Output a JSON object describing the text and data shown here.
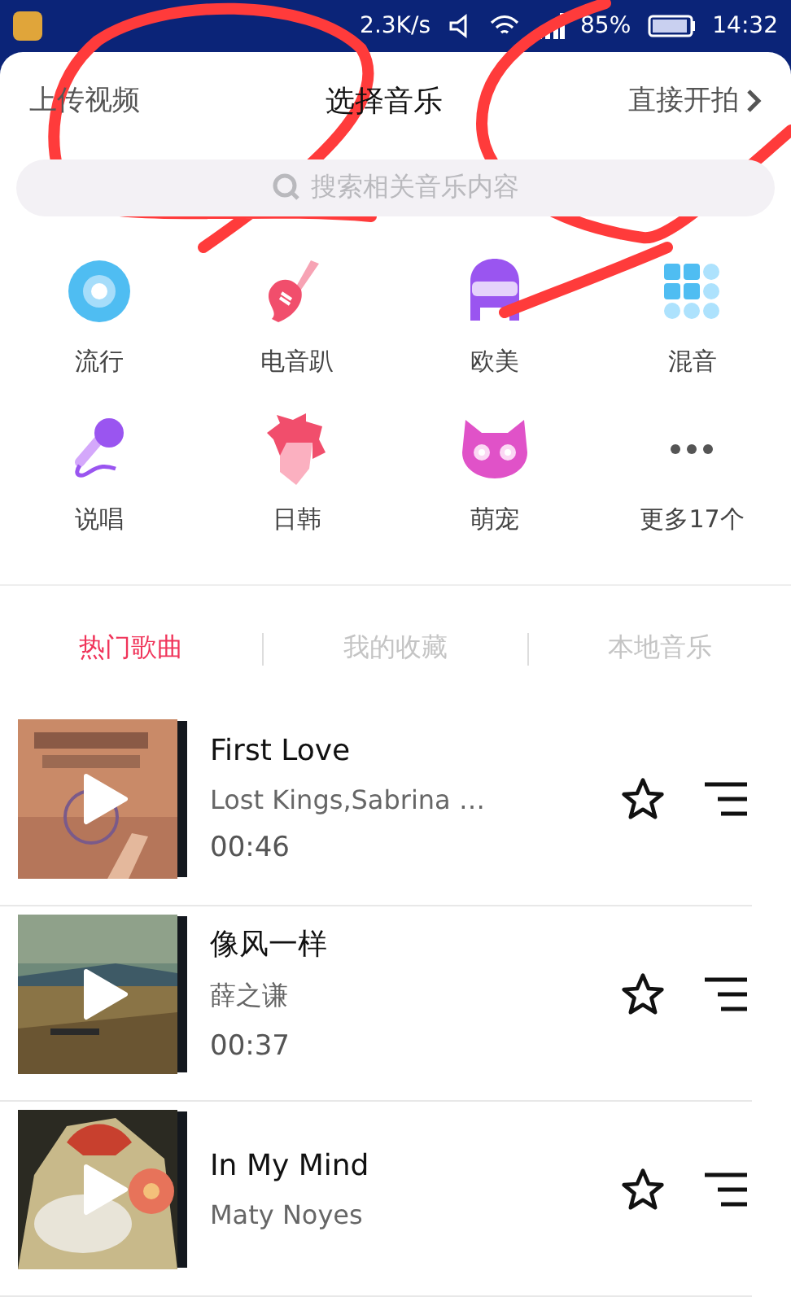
{
  "status_bar": {
    "speed": "2.3K/s",
    "battery": "85%",
    "time": "14:32"
  },
  "header": {
    "left": "上传视频",
    "title": "选择音乐",
    "right": "直接开拍"
  },
  "search": {
    "placeholder": "搜索相关音乐内容"
  },
  "categories": [
    {
      "label": "流行",
      "kind": "disc"
    },
    {
      "label": "电音趴",
      "kind": "guitar"
    },
    {
      "label": "欧美",
      "kind": "rocker"
    },
    {
      "label": "混音",
      "kind": "grid"
    },
    {
      "label": "说唱",
      "kind": "mic"
    },
    {
      "label": "日韩",
      "kind": "hair"
    },
    {
      "label": "萌宠",
      "kind": "cat"
    },
    {
      "label": "更多17个",
      "kind": "more"
    }
  ],
  "tabs": [
    {
      "label": "热门歌曲",
      "selected": true
    },
    {
      "label": "我的收藏",
      "selected": false
    },
    {
      "label": "本地音乐",
      "selected": false
    }
  ],
  "songs": [
    {
      "title": "First Love",
      "artist": "Lost Kings,Sabrina …",
      "duration": "00:46",
      "kind": "picture"
    },
    {
      "title": "像风一样",
      "artist": "薛之谦",
      "duration": "00:37",
      "kind": "picture"
    },
    {
      "title": "In My Mind",
      "artist": "Maty Noyes",
      "kind": "picture"
    }
  ]
}
